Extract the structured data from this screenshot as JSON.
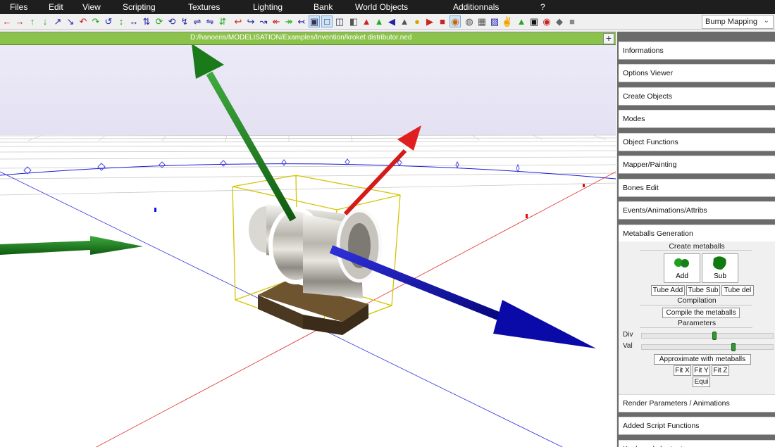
{
  "menu": [
    "Files",
    "Edit",
    "View",
    "Scripting",
    "Textures",
    "Lighting",
    "Bank",
    "World Objects",
    "Additionnals",
    "?"
  ],
  "toolbar": {
    "icons": [
      "undo-arrow-icon",
      "redo-arrow-icon",
      "move-y-up-icon",
      "move-y-down-icon",
      "move-x-icon",
      "move-z-icon",
      "rotate-x-icon",
      "rotate-y-icon",
      "rotate-z-icon",
      "scale-x-icon",
      "scale-y-icon",
      "scale-z-icon",
      "axis-snap-icon",
      "cut-icon",
      "slice-icon",
      "knife-icon",
      "weld-icon",
      "extrude-icon",
      "select-mode-icon",
      "face-mode-icon",
      "cube-icon",
      "axis-view-icon",
      "cone-icon",
      "shape-icon",
      "light-bulb-icon",
      "play-icon",
      "record-icon",
      "paint-icon",
      "texture-icon",
      "lock-icon",
      "bank-icon",
      "export-icon",
      "save-icon",
      "camera-icon",
      "render-icon",
      "stop-icon",
      "settings-icon",
      "grid-icon"
    ],
    "render_mode": "Bump Mapping"
  },
  "viewport": {
    "file_path": "D:/hanoeris/MODELISATION/Examples/Invention/kroket distributor.ned",
    "add_view_label": "+"
  },
  "panel": {
    "sections_top": [
      "Informations",
      "Options Viewer",
      "Create Objects",
      "Modes",
      "Object Functions",
      "Mapper/Painting",
      "Bones Edit",
      "Events/Animations/Attribs",
      "Metaballs Generation"
    ],
    "metaballs": {
      "create_title": "Create metaballs",
      "add_label": "Add",
      "sub_label": "Sub",
      "tube_add": "Tube Add",
      "tube_sub": "Tube Sub",
      "tube_del": "Tube del",
      "compilation_title": "Compilation",
      "compile_label": "Compile the metaballs",
      "parameters_title": "Parameters",
      "div_label": "Div",
      "val_label": "Val",
      "div_value": 0.55,
      "val_value": 0.7,
      "approx_label": "Approximate with metaballs",
      "fit_x": "Fit X",
      "fit_y": "Fit Y",
      "fit_z": "Fit Z",
      "equi": "Equi"
    },
    "sections_bottom": [
      "Render Parameters / Animations",
      "Added Script Functions",
      "Keyboard shortcuts"
    ]
  },
  "colors": {
    "path_bar": "#8bc34a",
    "menubar": "#1e1e1e",
    "axis_x": "#e02020",
    "axis_y": "#1a6b1a",
    "axis_z": "#1010b0",
    "bbox": "#d4c400"
  }
}
